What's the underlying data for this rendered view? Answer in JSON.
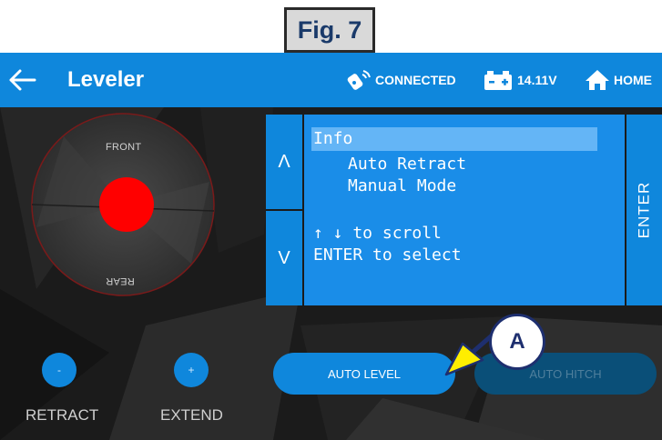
{
  "figure": {
    "label": "Fig. 7"
  },
  "header": {
    "title": "Leveler",
    "connection": "CONNECTED",
    "battery": "14.11V",
    "home": "HOME"
  },
  "joystick": {
    "front": "FRONT",
    "rear": "REAR"
  },
  "menu": {
    "up": "Λ",
    "down": "V",
    "enter": "ENTER",
    "items": [
      "Info",
      "Auto Retract",
      "Manual Mode"
    ],
    "help_scroll": "↑ ↓ to scroll",
    "help_select": "ENTER to select"
  },
  "controls": {
    "retract_symbol": "-",
    "extend_symbol": "+",
    "retract_label": "RETRACT",
    "extend_label": "EXTEND",
    "auto_level": "AUTO LEVEL",
    "auto_hitch": "AUTO HITCH"
  },
  "callout": {
    "letter": "A"
  },
  "colors": {
    "accent": "#0f87dc",
    "screen": "#1a8de8",
    "selection": "#64b5f6",
    "joystick_ball": "#ff0000",
    "callout_arrow": "#ffee00"
  },
  "icons": [
    "back-arrow-icon",
    "remote-connected-icon",
    "battery-icon",
    "home-icon"
  ]
}
